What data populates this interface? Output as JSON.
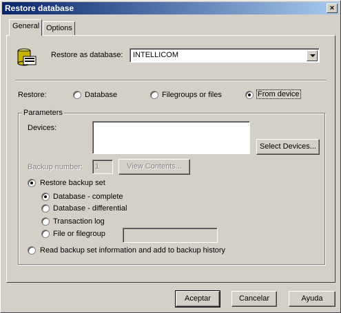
{
  "window": {
    "title": "Restore database",
    "close_label": "×"
  },
  "tabs": [
    {
      "label": "General",
      "active": true
    },
    {
      "label": "Options",
      "active": false
    }
  ],
  "restore_as": {
    "label": "Restore as database:",
    "value": "INTELLICOM"
  },
  "restore": {
    "label": "Restore:",
    "options": [
      {
        "label": "Database",
        "checked": false
      },
      {
        "label": "Filegroups or files",
        "checked": false
      },
      {
        "label": "From device",
        "checked": true
      }
    ]
  },
  "parameters": {
    "label": "Parameters",
    "devices_label": "Devices:",
    "select_devices_button": "Select Devices...",
    "backup_number_label": "Backup number:",
    "backup_number_value": "1",
    "view_contents_button": "View Contents...",
    "restore_backup_set_label": "Restore backup set",
    "backup_set_options": [
      {
        "label": "Database - complete",
        "checked": true
      },
      {
        "label": "Database - differential",
        "checked": false
      },
      {
        "label": "Transaction log",
        "checked": false
      },
      {
        "label": "File or filegroup",
        "checked": false
      }
    ],
    "read_info_label": "Read backup set information and add to backup history"
  },
  "footer": {
    "ok": "Aceptar",
    "cancel": "Cancelar",
    "help": "Ayuda"
  }
}
